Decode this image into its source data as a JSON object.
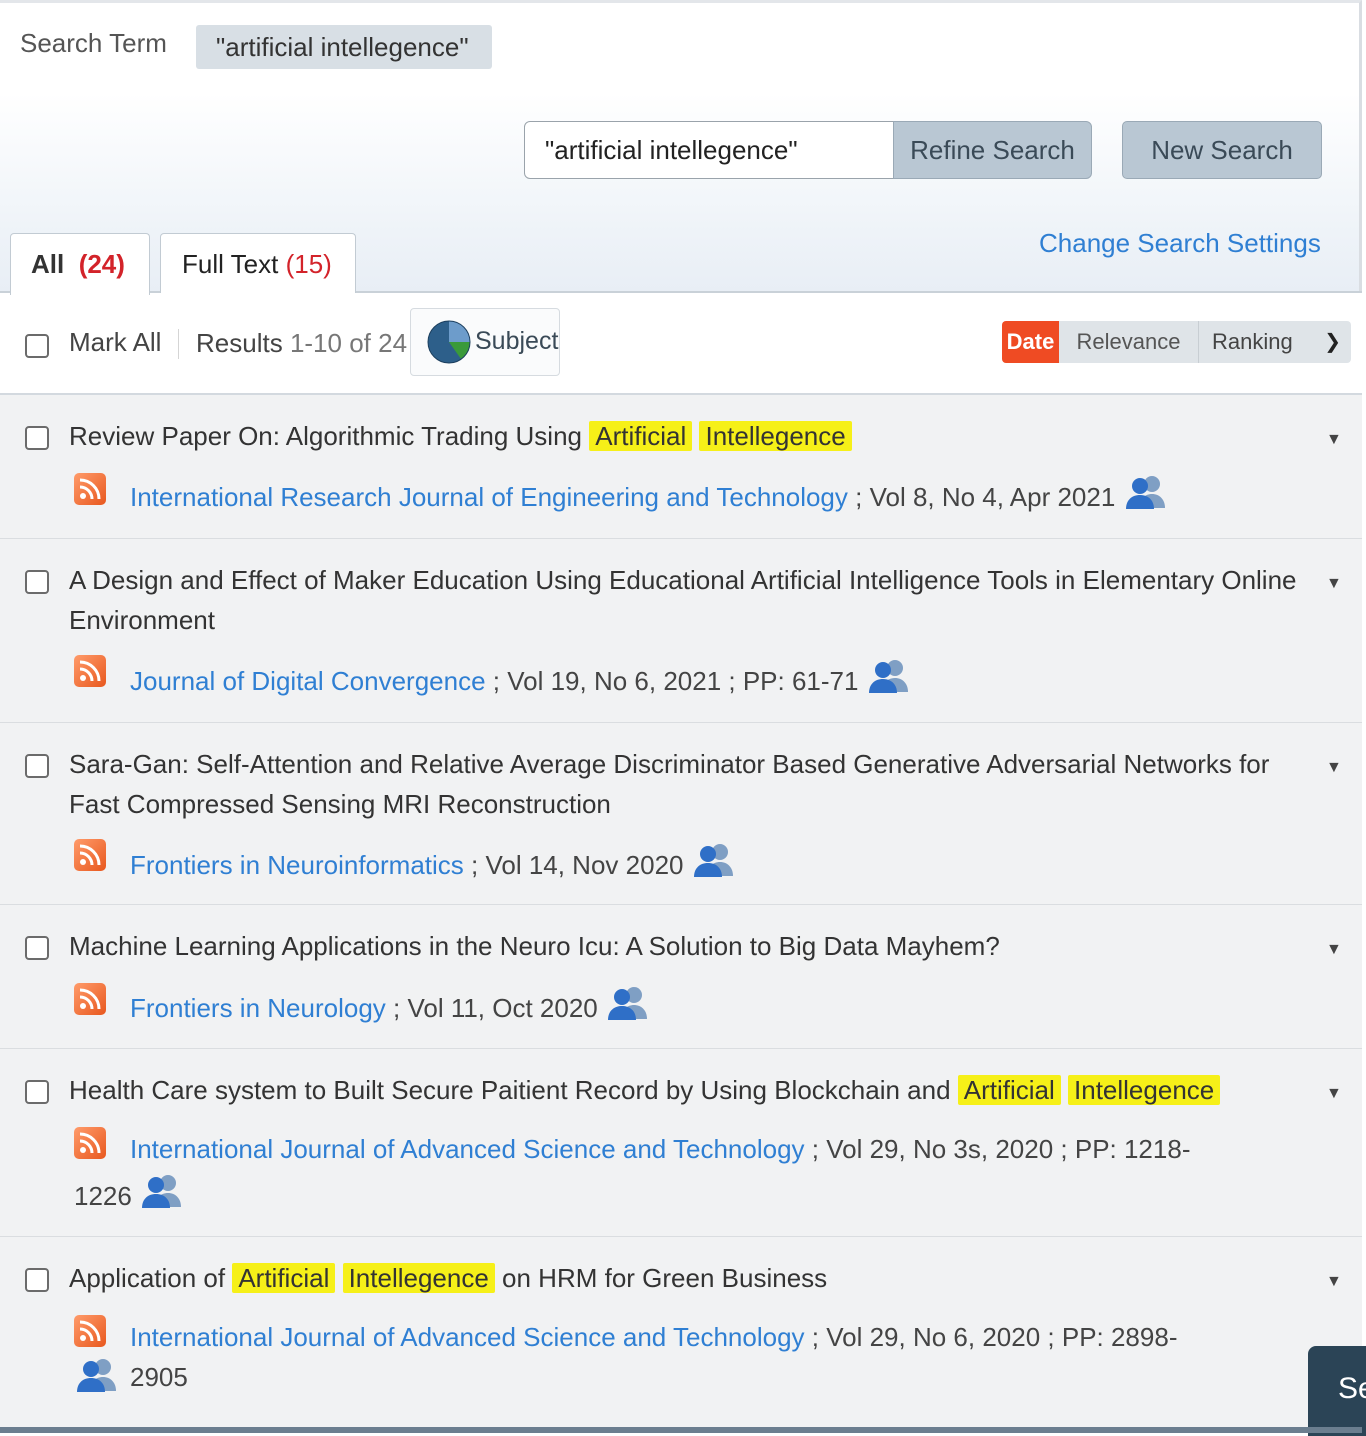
{
  "search": {
    "term_label": "Search Term",
    "term_value": "\"artificial intellegence\"",
    "input_value": "\"artificial intellegence\"",
    "refine_label": "Refine Search",
    "new_label": "New Search",
    "change_settings": "Change Search Settings"
  },
  "tabs": [
    {
      "label": "All",
      "count": "(24)"
    },
    {
      "label": "Full Text",
      "count": "(15)"
    }
  ],
  "toolbar": {
    "mark_all": "Mark All",
    "results_label": "Results",
    "results_range": "1-10 of 24",
    "subject": "Subject",
    "sort_date": "Date",
    "sort_relevance": "Relevance",
    "sort_ranking": "Ranking"
  },
  "results": [
    {
      "title_pre": "Review Paper On: Algorithmic Trading Using ",
      "hl1": "Artificial",
      "hl2": "Intellegence",
      "title_post": "",
      "journal": "International Research Journal of Engineering and Technology",
      "meta": " ; Vol 8, No 4, Apr 2021"
    },
    {
      "title": "A Design and Effect of Maker Education Using Educational Artificial Intelligence Tools in Elementary Online Environment",
      "journal": "Journal of Digital Convergence",
      "meta": " ; Vol 19, No 6, 2021 ; PP: 61-71"
    },
    {
      "title": "Sara-Gan: Self-Attention and Relative Average Discriminator Based Generative Adversarial Networks for Fast Compressed Sensing MRI Reconstruction",
      "journal": "Frontiers in Neuroinformatics",
      "meta": " ; Vol 14, Nov 2020"
    },
    {
      "title": "Machine Learning Applications in the Neuro Icu: A Solution to Big Data Mayhem?",
      "journal": "Frontiers in Neurology",
      "meta": " ; Vol 11, Oct 2020"
    },
    {
      "title_pre": "Health Care system to Built Secure Paitient Record by Using Blockchain and ",
      "hl1": "Artificial",
      "hl2": "Intellegence",
      "title_post": "",
      "journal": "International Journal of Advanced Science and Technology",
      "meta": " ; Vol 29, No 3s, 2020 ; PP: 1218-",
      "meta_cont": "1226"
    },
    {
      "title_pre": "Application of ",
      "hl1": "Artificial",
      "hl2": "Intellegence",
      "title_post": " on HRM for Green Business",
      "journal": "International Journal of Advanced Science and Technology",
      "meta": " ; Vol 29, No 6, 2020 ; PP: 2898-2905"
    }
  ],
  "chat": {
    "label": "Se"
  },
  "colors": {
    "link": "#2f7fd3",
    "highlight": "#f6f018",
    "date_sort": "#ef4b23",
    "count": "#d3232a"
  }
}
